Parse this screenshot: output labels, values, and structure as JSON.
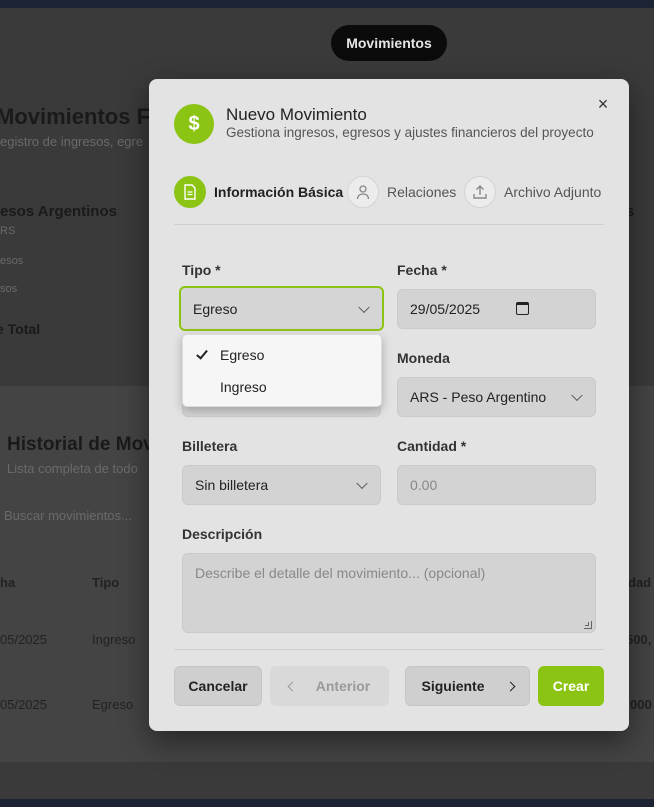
{
  "background": {
    "pill": "Movimientos",
    "title": "Movimientos F",
    "subtitle": "egistro de ingresos, egre",
    "card_heading": "esos Argentinos",
    "card_s1": "RS",
    "card_s2": "esos",
    "card_s3": "sos",
    "card_total": "e Total",
    "right_heading": "s",
    "history_title": "Historial de Mov",
    "history_sub": "Lista completa de todo",
    "search": "Buscar movimientos...",
    "col_fecha": "ha",
    "col_tipo": "Tipo",
    "col_right": "dad",
    "rows": [
      {
        "date": "05/2025",
        "type": "Ingreso",
        "amount": "500,"
      },
      {
        "date": "05/2025",
        "type": "Egreso",
        "amount": "000"
      }
    ]
  },
  "modal": {
    "title": "Nuevo Movimiento",
    "subtitle": "Gestiona ingresos, egresos y ajustes financieros del proyecto",
    "header_icon": "$",
    "close": "×",
    "steps": [
      {
        "label": "Información Básica",
        "icon": "document-icon",
        "active": true
      },
      {
        "label": "Relaciones",
        "icon": "user-icon",
        "active": false
      },
      {
        "label": "Archivo Adjunto",
        "icon": "upload-icon",
        "active": false
      }
    ],
    "fields": {
      "tipo_label": "Tipo *",
      "tipo_value": "Egreso",
      "fecha_label": "Fecha *",
      "fecha_value": "29/05/2025",
      "moneda_label": "Moneda",
      "moneda_value": "ARS - Peso Argentino",
      "billetera_label": "Billetera",
      "billetera_value": "Sin billetera",
      "cantidad_label": "Cantidad *",
      "cantidad_placeholder": "0.00",
      "descripcion_label": "Descripción",
      "descripcion_placeholder": "Describe el detalle del movimiento... (opcional)"
    },
    "tipo_options": [
      {
        "label": "Egreso",
        "selected": true
      },
      {
        "label": "Ingreso",
        "selected": false
      }
    ],
    "buttons": {
      "cancel": "Cancelar",
      "previous": "Anterior",
      "next": "Siguiente",
      "create": "Crear"
    }
  },
  "colors": {
    "accent": "#8cc414"
  }
}
